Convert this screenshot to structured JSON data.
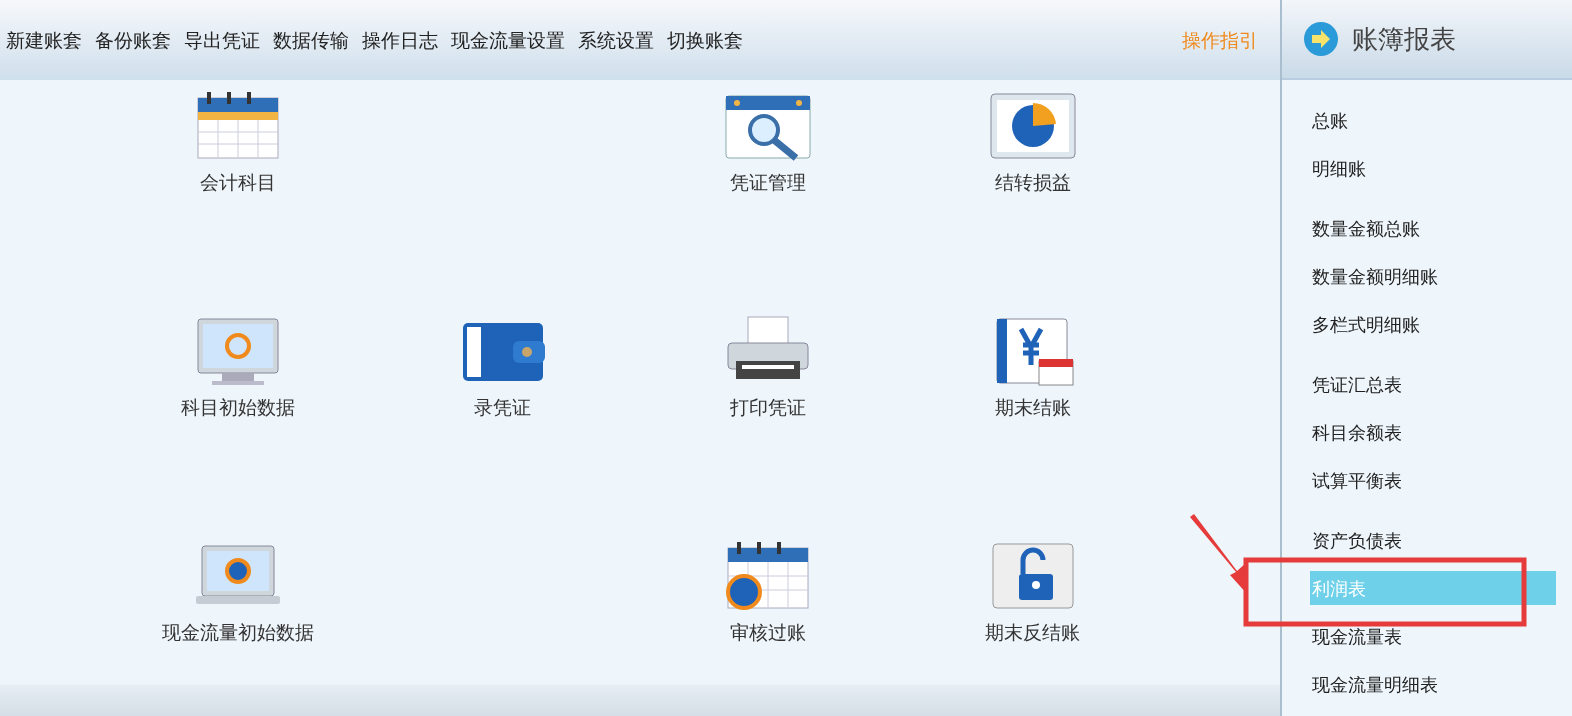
{
  "toolbar": {
    "items": [
      "新建账套",
      "备份账套",
      "导出凭证",
      "数据传输",
      "操作日志",
      "现金流量设置",
      "系统设置",
      "切换账套"
    ],
    "guide": "操作指引"
  },
  "tiles": [
    [
      {
        "kind": "tile",
        "label": "会计科目"
      },
      {
        "kind": "blank"
      },
      {
        "kind": "tile",
        "label": "凭证管理"
      },
      {
        "kind": "tile",
        "label": "结转损益"
      }
    ],
    [
      {
        "kind": "tile",
        "label": "科目初始数据"
      },
      {
        "kind": "tile",
        "label": "录凭证"
      },
      {
        "kind": "tile",
        "label": "打印凭证"
      },
      {
        "kind": "tile",
        "label": "期末结账"
      }
    ],
    [
      {
        "kind": "tile",
        "label": "现金流量初始数据"
      },
      {
        "kind": "blank"
      },
      {
        "kind": "tile",
        "label": "审核过账"
      },
      {
        "kind": "tile",
        "label": "期末反结账"
      }
    ]
  ],
  "sidebar": {
    "title": "账簿报表",
    "groups": [
      [
        {
          "label": "总账",
          "selected": false
        },
        {
          "label": "明细账",
          "selected": false
        }
      ],
      [
        {
          "label": "数量金额总账",
          "selected": false
        },
        {
          "label": "数量金额明细账",
          "selected": false
        },
        {
          "label": "多栏式明细账",
          "selected": false
        }
      ],
      [
        {
          "label": "凭证汇总表",
          "selected": false
        },
        {
          "label": "科目余额表",
          "selected": false
        },
        {
          "label": "试算平衡表",
          "selected": false
        }
      ],
      [
        {
          "label": "资产负债表",
          "selected": false
        },
        {
          "label": "利润表",
          "selected": true
        },
        {
          "label": "现金流量表",
          "selected": false
        },
        {
          "label": "现金流量明细表",
          "selected": false
        }
      ]
    ]
  }
}
